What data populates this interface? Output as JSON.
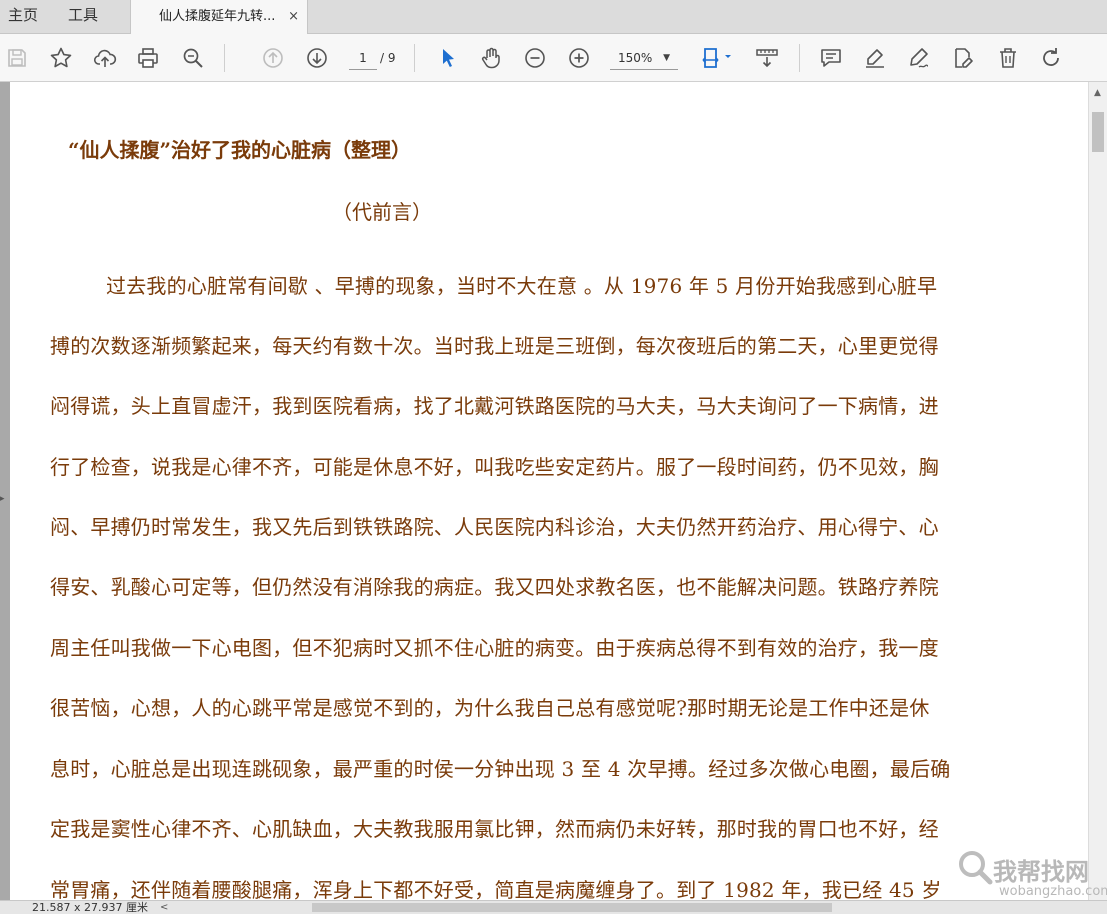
{
  "tabs": {
    "home": "主页",
    "tools": "工具",
    "document": "仙人揉腹延年九转...",
    "close": "×"
  },
  "toolbar": {
    "current_page": "1",
    "total_pages": "/ 9",
    "zoom": "150%",
    "icons": [
      "save-icon",
      "bookmark-star-icon",
      "upload-icon",
      "print-icon",
      "zoom-search-icon",
      "page-up-icon",
      "page-down-icon",
      "zoom-out-icon",
      "zoom-in-icon",
      "select-pointer-icon",
      "hand-icon",
      "fit-page-icon",
      "measure-icon",
      "comment-icon",
      "highlight-icon",
      "sign-icon",
      "edit-icon",
      "delete-icon",
      "rotate-icon"
    ],
    "accent": "#1e6fd0"
  },
  "document": {
    "title": "“仙人揉腹”治好了我的心脏病（整理）",
    "subtitle": "（代前言）",
    "lines": [
      "过去我的心脏常有间歇 、早搏的现象，当时不大在意 。从 1976 年 5 月份开始我感到心脏早",
      "搏的次数逐渐频繁起来，每天约有数十次。当时我上班是三班倒，每次夜班后的第二天，心里更觉得",
      "闷得谎，头上直冒虚汗，我到医院看病，找了北戴河铁路医院的马大夫，马大夫询问了一下病情，进",
      "行了检查，说我是心律不齐，可能是休息不好，叫我吃些安定药片。服了一段时间药，仍不见效，胸",
      "闷、早搏仍时常发生，我又先后到铁铁路院、人民医院内科诊治，大夫仍然开药治疗、用心得宁、心",
      "得安、乳酸心可定等，但仍然没有消除我的病症。我又四处求教名医，也不能解决问题。铁路疗养院",
      "周主任叫我做一下心电图，但不犯病时又抓不住心脏的病变。由于疾病总得不到有效的治疗，我一度",
      "很苦恼，心想，人的心跳平常是感觉不到的，为什么我自己总有感觉呢?那时期无论是工作中还是休",
      "息时，心脏总是出现连跳砚象，最严重的时侯一分钟出现 3 至 4 次早搏。经过多次做心电圈，最后确",
      "定我是窦性心律不齐、心肌缺血，大夫教我服用氯比钾，然而病仍未好转，那时我的胃口也不好，经",
      "常胃痛，还伴随着腰酸腿痛，浑身上下都不好受，简直是病魔缠身了。到了 1982 年，我已经 45 岁"
    ],
    "text_color": "#7a3b0a"
  },
  "watermark": {
    "cn": "我帮找网",
    "en": "wobangzhao.com"
  },
  "status": {
    "dimensions": "21.587 x 27.937 厘米"
  }
}
